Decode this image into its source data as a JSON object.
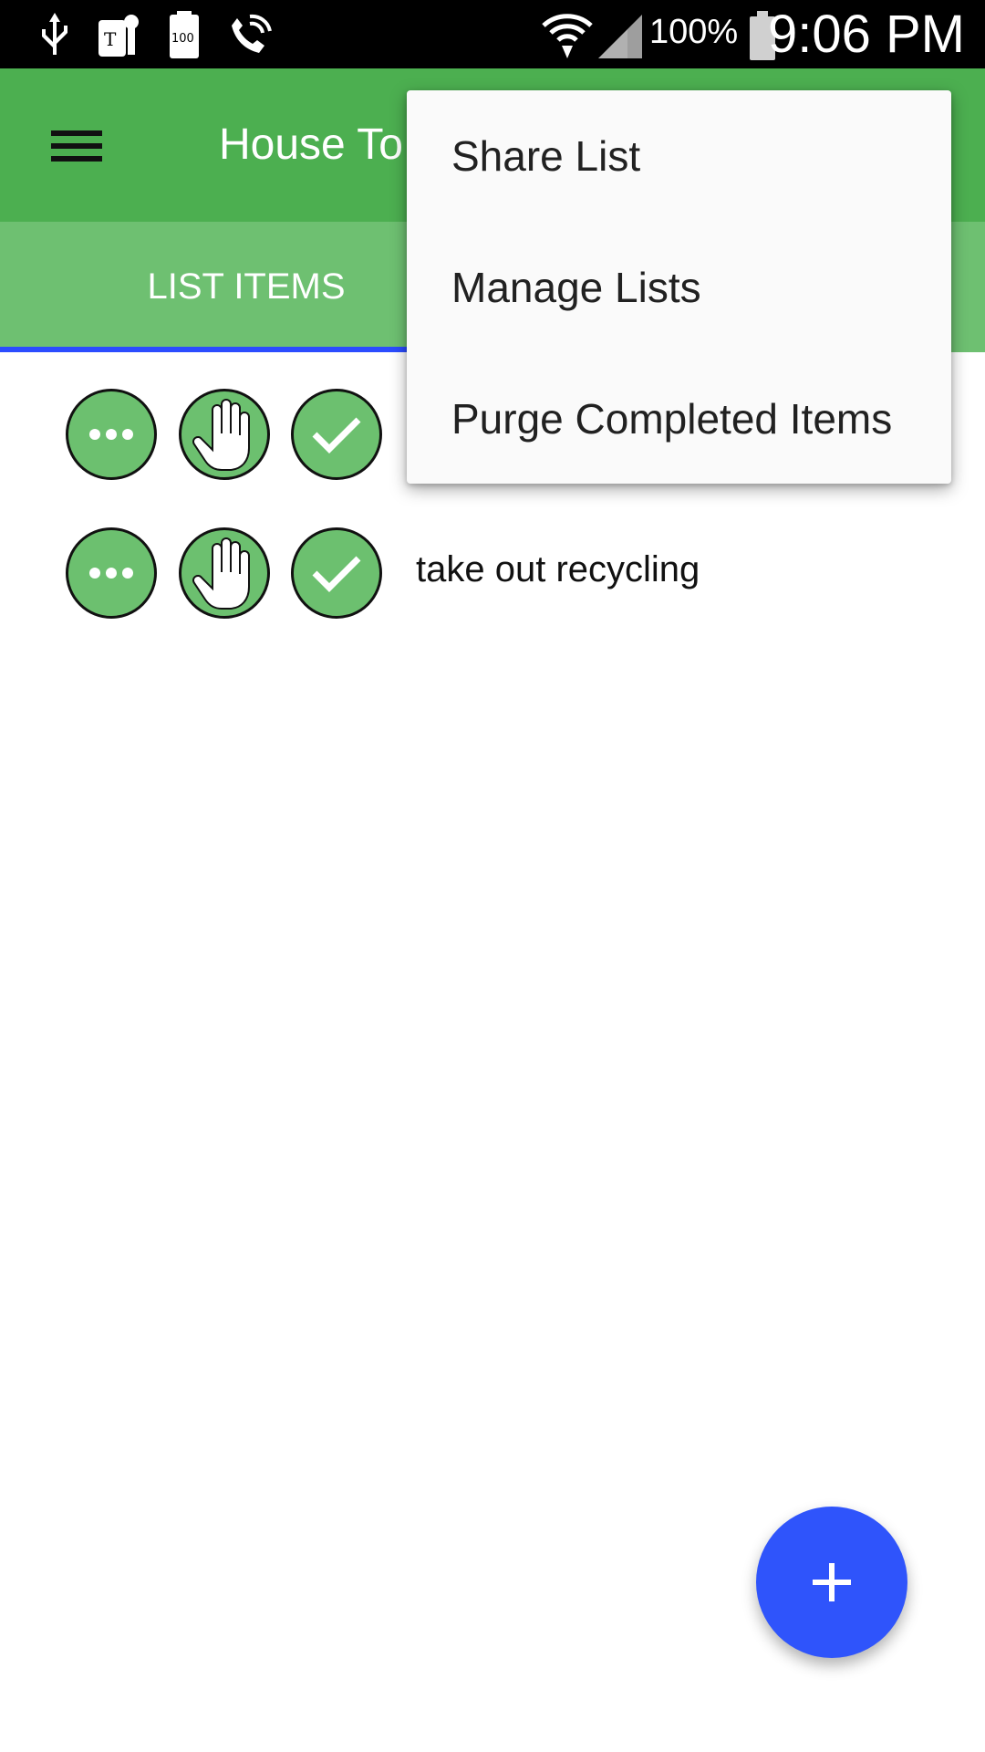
{
  "status_bar": {
    "battery_percent": "100%",
    "time": "9:06 PM",
    "icons": [
      "usb-icon",
      "t-mobile-icon",
      "battery-100-icon",
      "wifi-call-icon",
      "wifi-icon",
      "signal-icon",
      "battery-icon"
    ]
  },
  "app_bar": {
    "title": "House To",
    "menu_icon": "hamburger-menu-icon"
  },
  "tabs": [
    {
      "label": "LIST ITEMS",
      "selected": true
    }
  ],
  "list": {
    "items": [
      {
        "text": "",
        "buttons": [
          "more-icon",
          "hand-icon",
          "check-icon"
        ]
      },
      {
        "text": "take out recycling",
        "buttons": [
          "more-icon",
          "hand-icon",
          "check-icon"
        ]
      }
    ]
  },
  "overflow_menu": {
    "items": [
      {
        "label": "Share List"
      },
      {
        "label": "Manage Lists"
      },
      {
        "label": "Purge Completed Items"
      }
    ]
  },
  "fab": {
    "icon": "add-icon"
  },
  "colors": {
    "app_bar": "#4caf50",
    "tab_bar": "#6ec071",
    "tab_indicator": "#2b4cff",
    "circle_button": "#6cc06f",
    "fab": "#2f54fb",
    "menu_bg": "#fafafa"
  }
}
